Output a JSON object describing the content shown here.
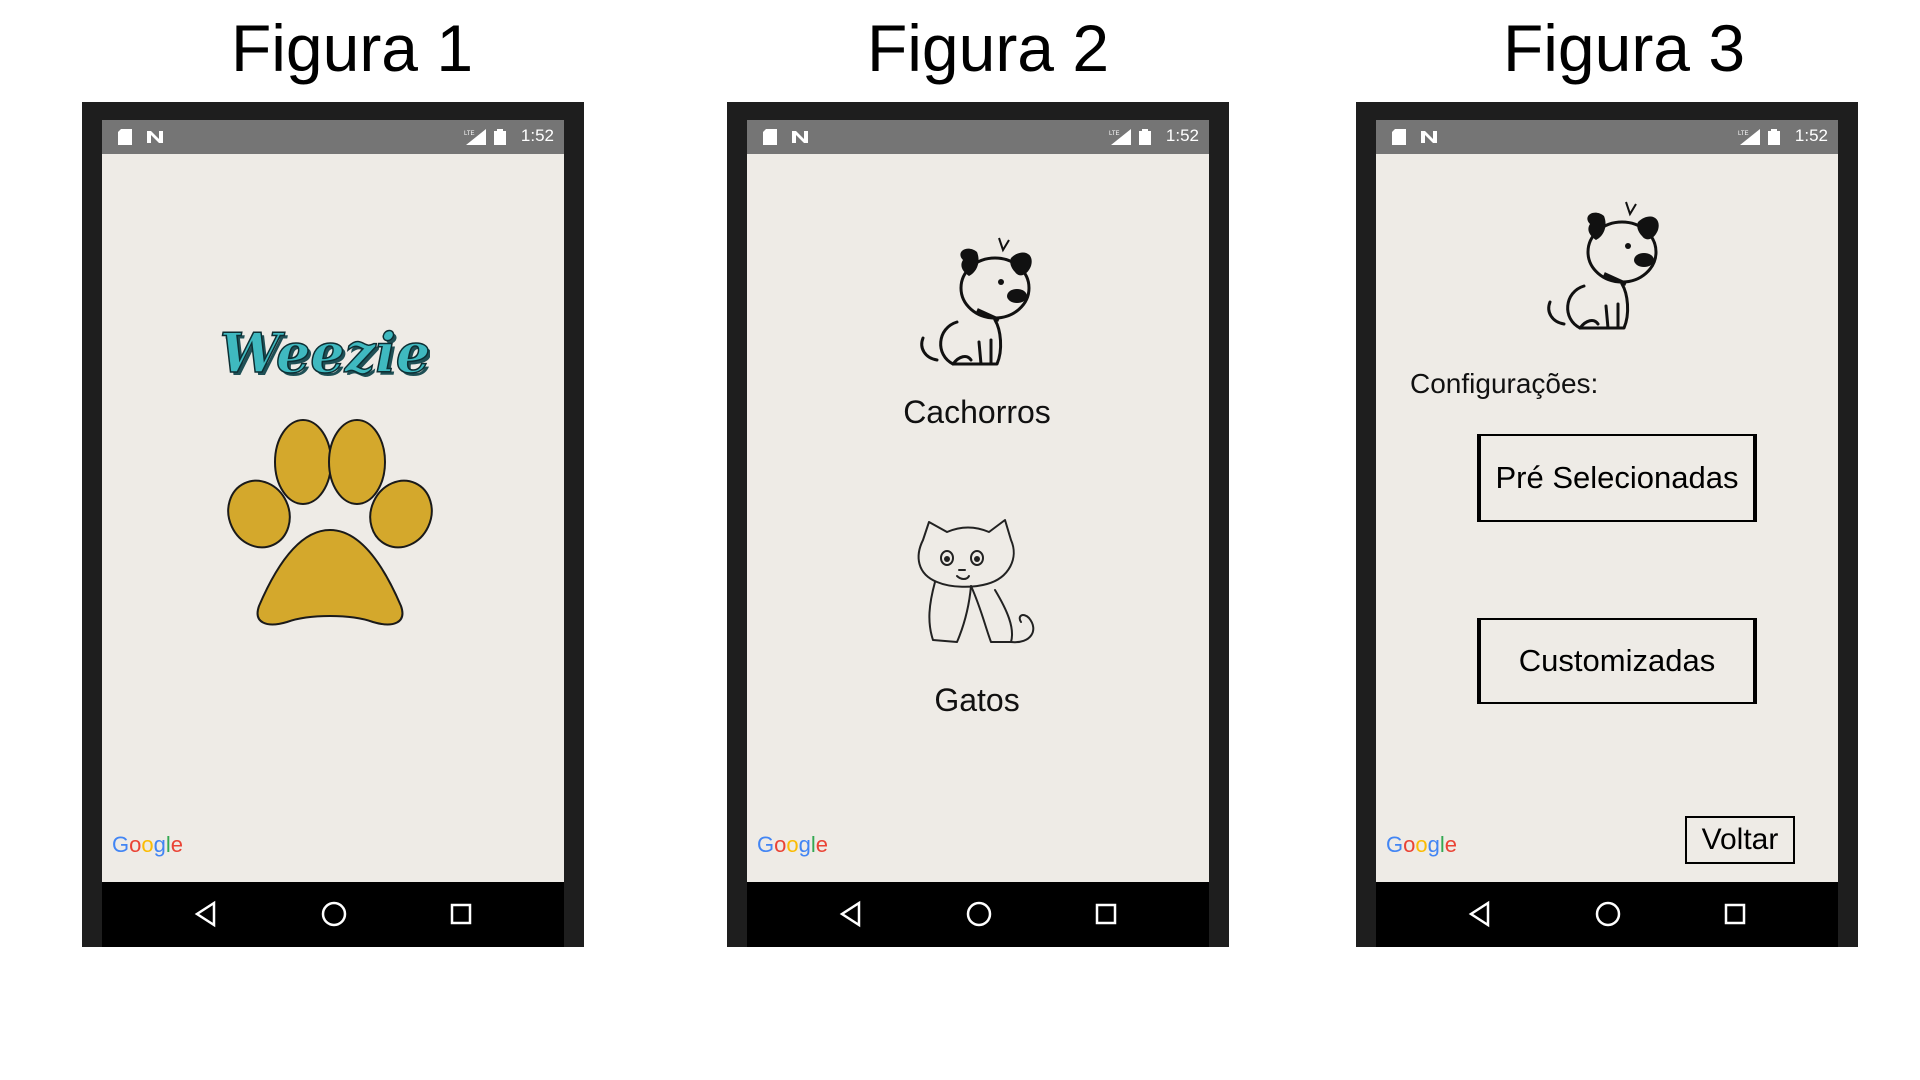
{
  "figures": [
    {
      "title": "Figura 1",
      "time": "1:52"
    },
    {
      "title": "Figura 2",
      "time": "1:52"
    },
    {
      "title": "Figura 3",
      "time": "1:52"
    }
  ],
  "status": {
    "network": "LTE"
  },
  "splash": {
    "logo_text": "Weezie",
    "paw_color": "#d4a82c"
  },
  "menu": {
    "dogs_label": "Cachorros",
    "cats_label": "Gatos"
  },
  "settings": {
    "heading": "Configurações:",
    "preselected_label": "Pré Selecionadas",
    "custom_label": "Customizadas",
    "back_label": "Voltar"
  },
  "google_mark": "Google",
  "icons": {
    "status": [
      "sd-card-icon",
      "n-icon",
      "lte-signal-icon",
      "battery-icon"
    ],
    "nav": [
      "back-icon",
      "home-icon",
      "recents-icon"
    ]
  },
  "colors": {
    "screen_bg": "#eeebe6",
    "status_bar": "#757575",
    "nav_bar": "#000000",
    "logo": "#3fb9c0"
  }
}
